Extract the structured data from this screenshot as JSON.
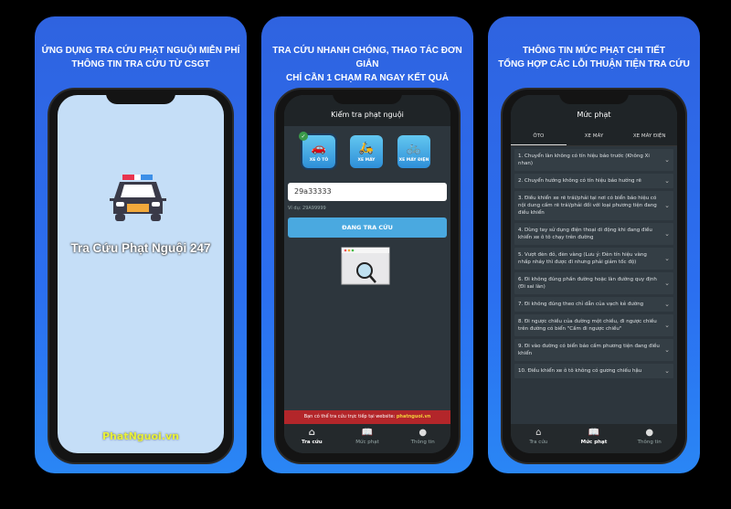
{
  "panels": [
    {
      "headline": [
        "ỨNG DỤNG TRA CỨU PHẠT NGUỘI MIỄN PHÍ",
        "THÔNG TIN TRA CỨU TỪ CSGT"
      ],
      "app_name": "Tra Cứu Phạt Nguội 247",
      "brand": "PhatNguoi.vn"
    },
    {
      "headline": [
        "TRA CỨU NHANH CHÓNG, THAO TÁC ĐƠN GIẢN",
        "CHỈ CẦN 1 CHẠM RA NGAY KẾT QUẢ"
      ],
      "title": "Kiểm tra phạt nguội",
      "vehicles": [
        {
          "label": "XE Ô TÔ",
          "icon": "car-icon",
          "selected": true
        },
        {
          "label": "XE MÁY",
          "icon": "scooter-icon",
          "selected": false
        },
        {
          "label": "XE MÁY ĐIỆN",
          "icon": "bicycle-icon",
          "selected": false
        }
      ],
      "plate_value": "29a33333",
      "plate_hint": "Ví dụ: 29A99999",
      "search_label": "ĐANG TRA CỨU",
      "banner_text": "Bạn có thể tra cứu trực tiếp tại website: ",
      "banner_link": "phatnguoi.vn"
    },
    {
      "headline": [
        "THÔNG TIN MỨC PHẠT CHI TIẾT",
        "TỔNG HỢP CÁC LỖI THUẬN TIỆN TRA CỨU"
      ],
      "title": "Mức phạt",
      "tabs": [
        "ÔTO",
        "XE MÁY",
        "XE MÁY ĐIỆN"
      ],
      "active_tab": 0,
      "items": [
        "1. Chuyển làn không có tín hiệu báo trước (Không Xi nhan)",
        "2. Chuyển hướng không có tín hiệu báo hướng rẽ",
        "3. Điều khiển xe rẽ trái/phải tại nơi có biển báo hiệu có nội dung cấm rẽ trái/phải đối với loại phương tiện đang điều khiển",
        "4. Dùng tay sử dụng điện thoại di động khi đang điều khiển xe ô tô chạy trên đường",
        "5. Vượt đèn đỏ, đèn vàng (Lưu ý: Đèn tín hiệu vàng nhấp nháy thì được đi nhưng phải giảm tốc độ)",
        "6. Đi không đúng phần đường hoặc làn đường quy định (Đi sai làn)",
        "7. Đi không đúng theo chỉ dẫn của vạch kẻ đường",
        "8. Đi ngược chiều của đường một chiều, đi ngược chiều trên đường có biển \"Cấm đi ngược chiều\"",
        "9. Đi vào đường có biển báo cấm phương tiện đang điều khiển",
        "10. Điều khiển xe ô tô không có gương chiếu hậu"
      ]
    }
  ],
  "tabbar": [
    {
      "label": "Tra cứu",
      "icon": "search-home-icon"
    },
    {
      "label": "Mức phạt",
      "icon": "book-icon"
    },
    {
      "label": "Thông tin",
      "icon": "user-icon"
    }
  ]
}
